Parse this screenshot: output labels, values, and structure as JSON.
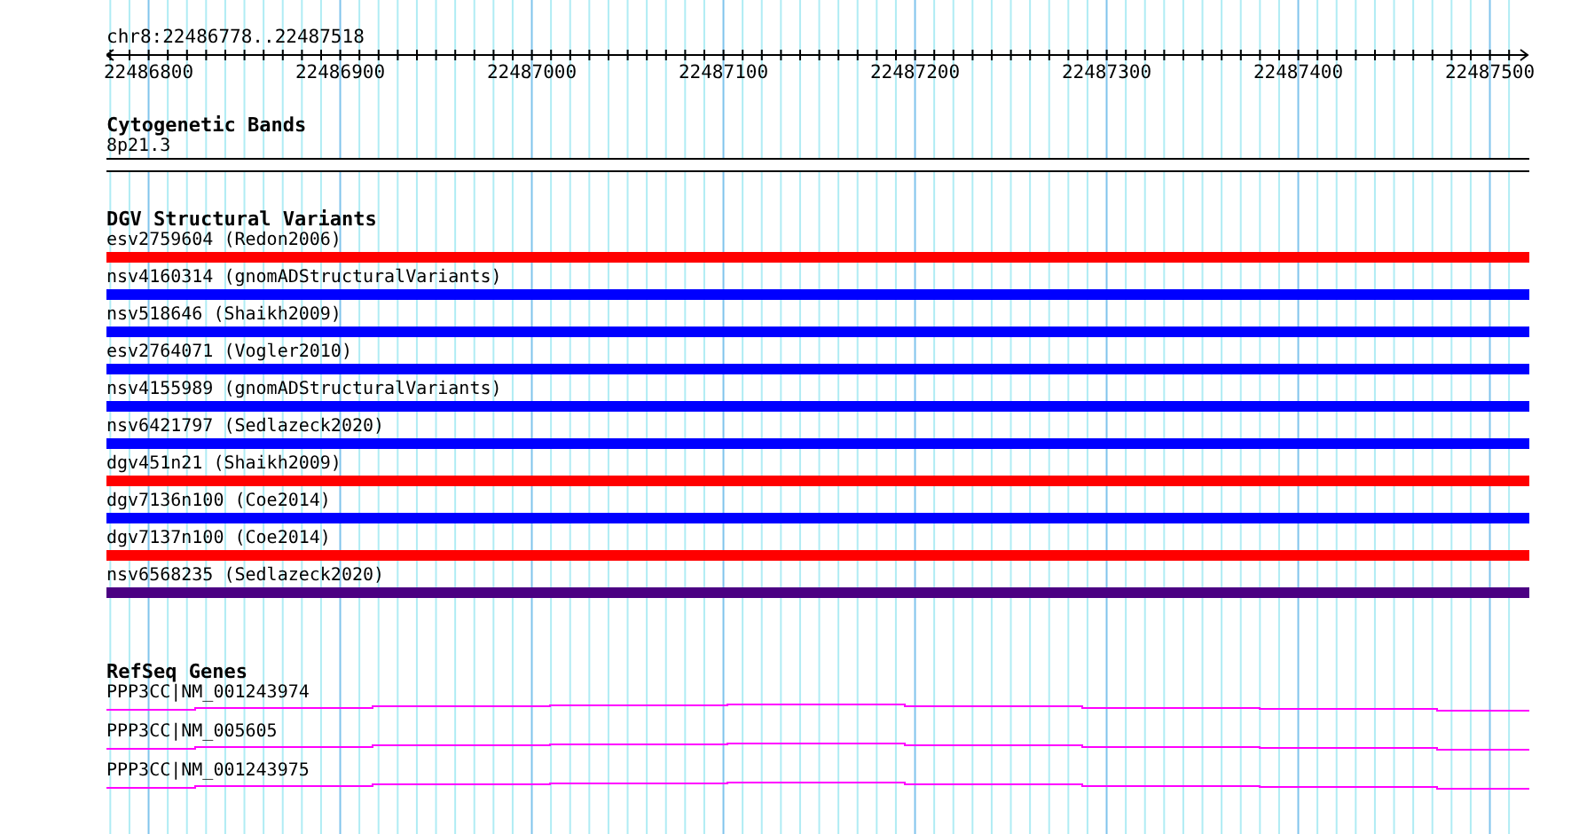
{
  "location": "chr8:22486778..22487518",
  "ruler": {
    "tick_labels": [
      "22486800",
      "22486900",
      "22487000",
      "22487100",
      "22487200",
      "22487300",
      "22487400",
      "22487500"
    ]
  },
  "tracks": [
    {
      "kind": "cytoband",
      "title": "Cytogenetic Bands",
      "features": [
        {
          "label": "8p21.3"
        }
      ]
    },
    {
      "kind": "variants",
      "title": "DGV Structural Variants",
      "features": [
        {
          "label": "esv2759604 (Redon2006)",
          "color": "#ff0000"
        },
        {
          "label": "nsv4160314 (gnomADStructuralVariants)",
          "color": "#0000ff"
        },
        {
          "label": "nsv518646 (Shaikh2009)",
          "color": "#0000ff"
        },
        {
          "label": "esv2764071 (Vogler2010)",
          "color": "#0000ff"
        },
        {
          "label": "nsv4155989 (gnomADStructuralVariants)",
          "color": "#0000ff"
        },
        {
          "label": "nsv6421797 (Sedlazeck2020)",
          "color": "#0000ff"
        },
        {
          "label": "dgv451n21 (Shaikh2009)",
          "color": "#ff0000"
        },
        {
          "label": "dgv7136n100 (Coe2014)",
          "color": "#0000ff"
        },
        {
          "label": "dgv7137n100 (Coe2014)",
          "color": "#ff0000"
        },
        {
          "label": "nsv6568235 (Sedlazeck2020)",
          "color": "#4b0082"
        }
      ]
    },
    {
      "kind": "genes",
      "title": "RefSeq Genes",
      "features": [
        {
          "label": "PPP3CC|NM_001243974"
        },
        {
          "label": "PPP3CC|NM_005605"
        },
        {
          "label": "PPP3CC|NM_001243975"
        }
      ]
    }
  ]
}
